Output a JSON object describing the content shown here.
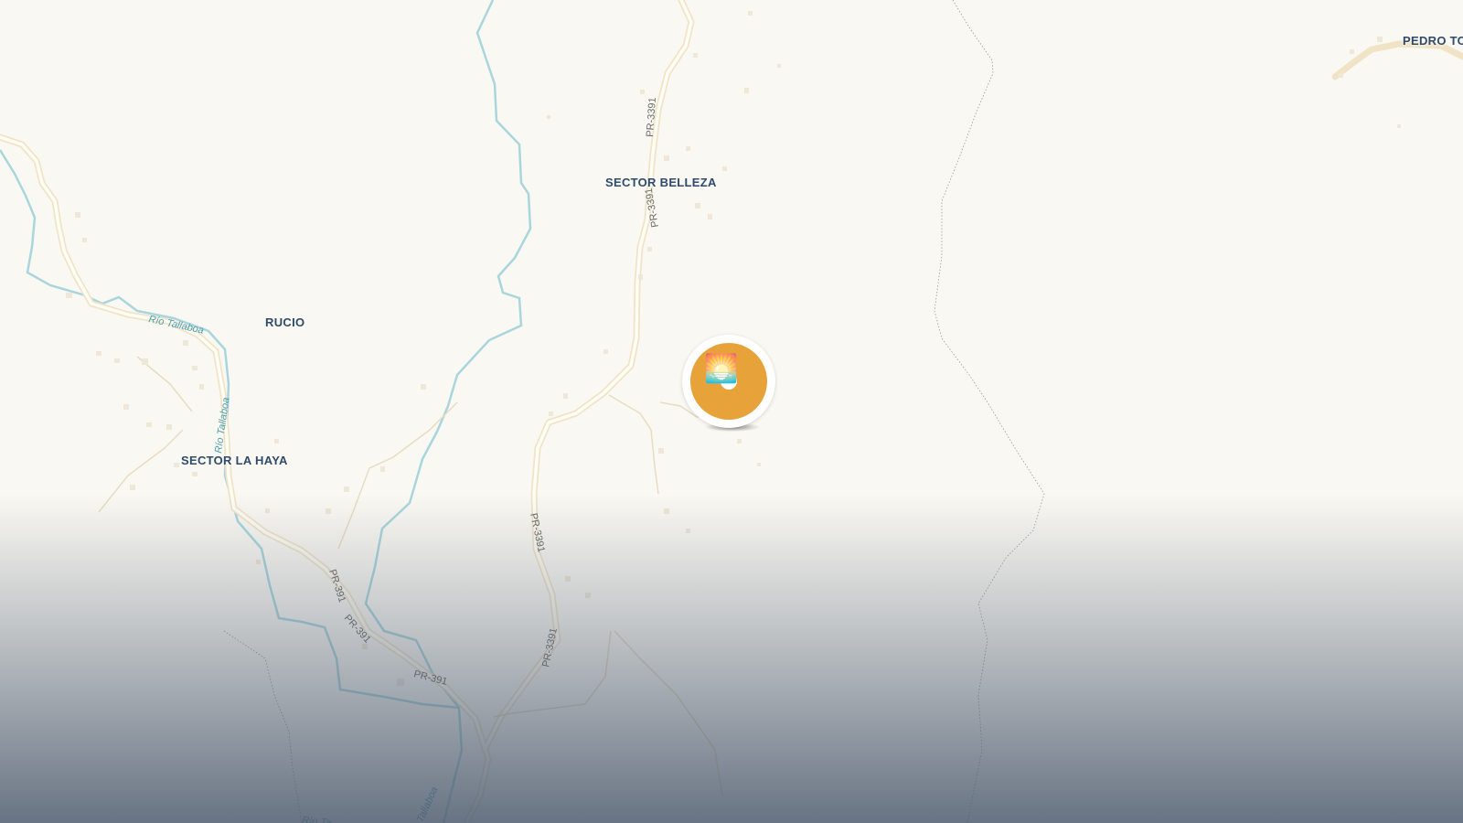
{
  "places": {
    "sector_belleza": "SECTOR BELLEZA",
    "rucio": "RUCIO",
    "sector_la_haya": "SECTOR LA HAYA",
    "pedro": "PEDRO TO"
  },
  "roads": {
    "pr3391_a": "PR-3391",
    "pr3391_b": "PR-3391",
    "pr3391_c": "PR-3391",
    "pr3391_d": "PR-3391",
    "pr391_a": "PR-391",
    "pr391_b": "PR-391",
    "pr391_c": "PR-391"
  },
  "water": {
    "rio_tallaboa": "Río Tallaboa",
    "rio_haya": "Río Tallaboa",
    "rio_bottom_a": "Río Ta",
    "rio_bottom_b": "Tallaboa"
  },
  "marker": {
    "icon": "photo-icon",
    "glyph": "🌅",
    "color": "#e8a23a"
  }
}
